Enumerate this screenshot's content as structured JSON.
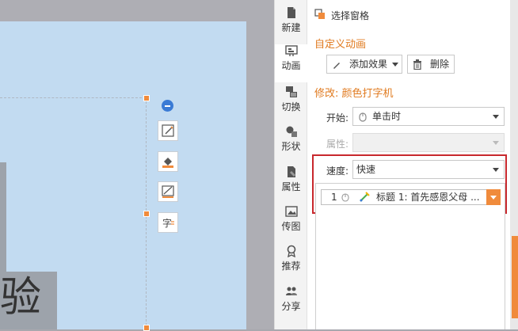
{
  "canvas": {
    "big_char": "验"
  },
  "tabs": [
    {
      "id": "new",
      "label": "新建",
      "icon": "new-file-icon"
    },
    {
      "id": "animation",
      "label": "动画",
      "icon": "animation-icon",
      "active": true
    },
    {
      "id": "transition",
      "label": "切换",
      "icon": "transition-icon"
    },
    {
      "id": "shape",
      "label": "形状",
      "icon": "shape-icon"
    },
    {
      "id": "property",
      "label": "属性",
      "icon": "property-icon"
    },
    {
      "id": "image",
      "label": "传图",
      "icon": "image-icon"
    },
    {
      "id": "recommend",
      "label": "推荐",
      "icon": "recommend-icon"
    },
    {
      "id": "share",
      "label": "分享",
      "icon": "share-icon"
    }
  ],
  "panel": {
    "select_pane": "选择窗格",
    "custom_animation": "自定义动画",
    "add_effect": "添加效果",
    "delete": "删除",
    "modify": "修改: 颜色打字机",
    "start_label": "开始:",
    "start_value": "单击时",
    "property_label": "属性:",
    "speed_label": "速度:",
    "speed_value": "快速",
    "items": [
      {
        "index": "1",
        "text": "标题 1: 首先感恩父母 ..."
      }
    ]
  },
  "colors": {
    "accent": "#e07a1f",
    "highlight_frame": "#c8282d",
    "slide_bg": "#c2dbf1"
  }
}
